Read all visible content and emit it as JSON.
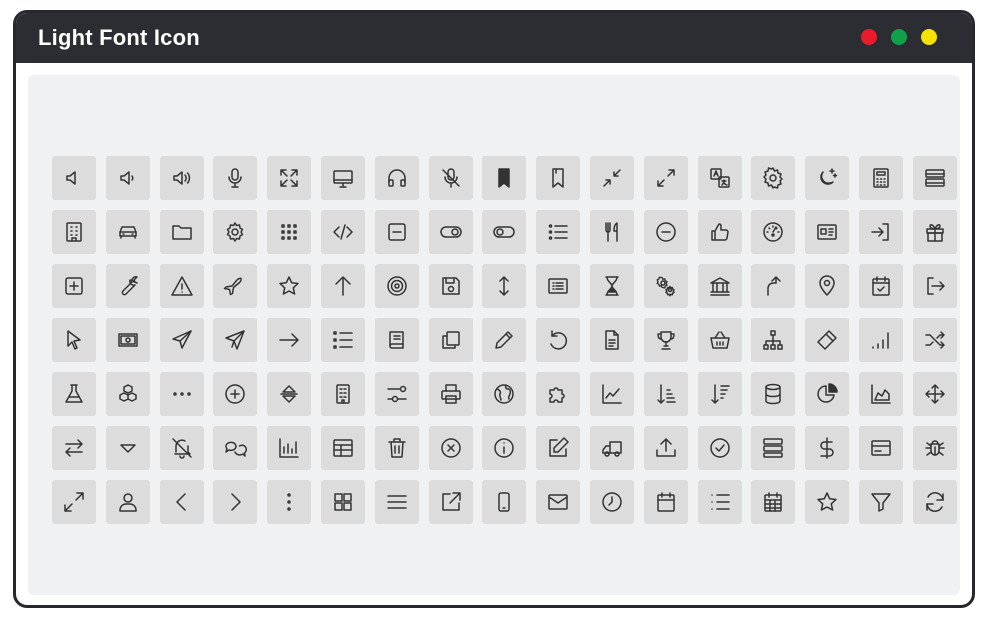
{
  "window": {
    "title": "Light Font Icon",
    "controls": [
      {
        "name": "close",
        "color": "#ea1c2c"
      },
      {
        "name": "maximize",
        "color": "#0fa14a"
      },
      {
        "name": "minimize",
        "color": "#f6e100"
      }
    ]
  },
  "icons": [
    [
      "volume-off",
      "volume-low",
      "volume-high",
      "microphone",
      "fullscreen",
      "monitor",
      "headphones",
      "microphone-off",
      "bookmark-filled",
      "bookmark",
      "collapse",
      "expand",
      "translate",
      "settings",
      "night-mode",
      "calculator",
      "server"
    ],
    [
      "building",
      "car",
      "folder",
      "cog",
      "grid",
      "code",
      "minus-square",
      "toggle-on",
      "toggle-off",
      "list",
      "restaurant",
      "minus-circle",
      "thumbs-up",
      "dashboard",
      "id-card",
      "sign-in",
      "gift"
    ],
    [
      "plus-square",
      "wrench",
      "warning",
      "airplane",
      "star",
      "arrow-up",
      "target",
      "save",
      "vertical-resize",
      "receipt",
      "hourglass",
      "cogs",
      "bank",
      "turn-up",
      "location",
      "calendar-check",
      "sign-out"
    ],
    [
      "cursor",
      "money",
      "paper-plane",
      "send",
      "arrow-right",
      "bullet-list",
      "book",
      "copy",
      "pencil",
      "undo",
      "document",
      "trophy",
      "basket",
      "sitemap",
      "ticket",
      "signal",
      "shuffle"
    ],
    [
      "flask",
      "cubes",
      "more-horizontal",
      "plus-circle",
      "sort",
      "office",
      "sliders",
      "printer",
      "globe",
      "puzzle",
      "line-chart",
      "sort-asc",
      "sort-desc",
      "database",
      "pie-chart",
      "area-chart",
      "move"
    ],
    [
      "exchange",
      "triangle-down",
      "bell-off",
      "comments",
      "bar-chart",
      "table",
      "trash",
      "times-circle",
      "info-circle",
      "edit",
      "truck",
      "upload",
      "check-circle",
      "storage",
      "dollar",
      "credit-card",
      "bug"
    ],
    [
      "expand-arrows",
      "user",
      "chevron-left",
      "chevron-right",
      "more-vertical",
      "th-large",
      "menu",
      "external-link",
      "mobile",
      "envelope",
      "clock",
      "calendar",
      "list-ul",
      "calendar-grid",
      "star-outline",
      "filter",
      "refresh"
    ]
  ]
}
